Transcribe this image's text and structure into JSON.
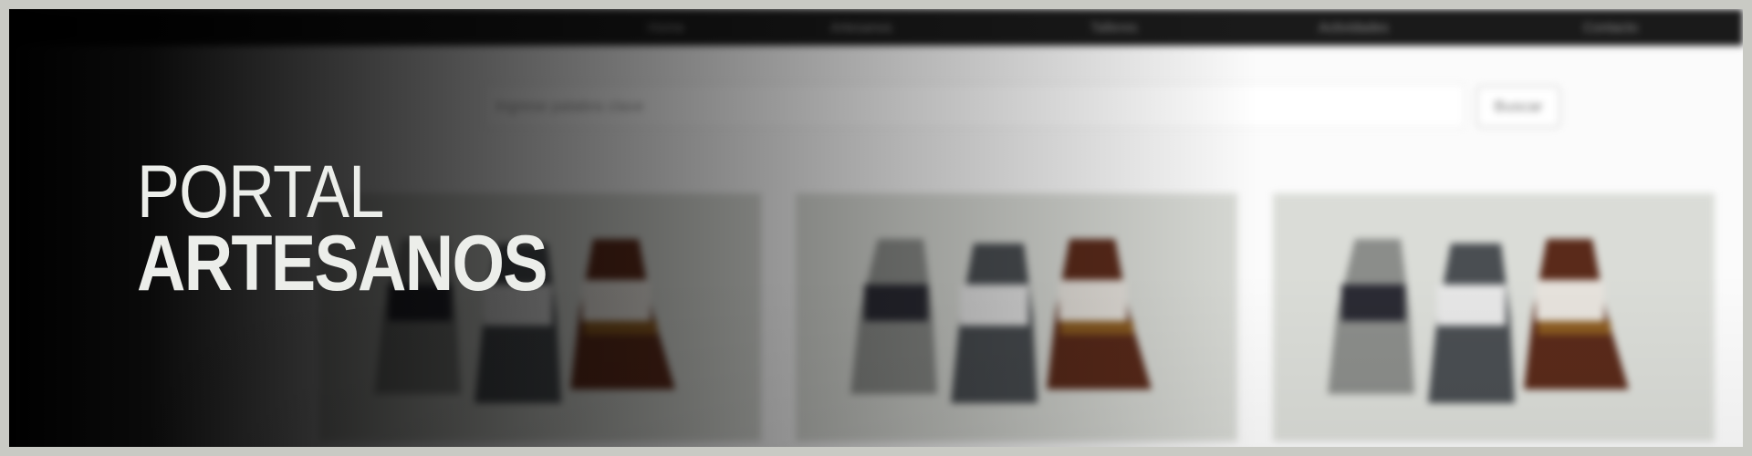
{
  "nav": {
    "items": [
      "Home",
      "Artesanos",
      "Talleres",
      "Actividades",
      "Contacto"
    ]
  },
  "search": {
    "placeholder": "Ingrese palabra clave",
    "button_label": "Buscar"
  },
  "brand": {
    "line1": "PORTAL",
    "line2": "ARTESANOS"
  },
  "colors": {
    "navbar": "#1a1a1a",
    "title_text": "#eceeea",
    "border": "#c9cac4"
  },
  "products": [
    {
      "icon": "gloves-image"
    },
    {
      "icon": "gloves-image"
    },
    {
      "icon": "gloves-image"
    }
  ]
}
